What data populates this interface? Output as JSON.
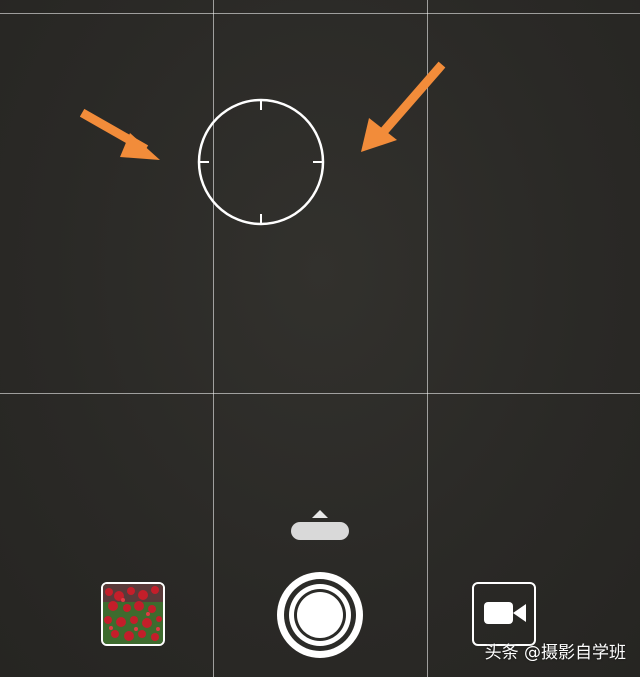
{
  "camera": {
    "mode": "photo",
    "grid": true,
    "focus_indicator": "circle-with-ticks",
    "annotation_color": "#f28c3a"
  },
  "controls": {
    "gallery_thumbnail": "gallery-thumbnail",
    "shutter": "shutter-button",
    "video_mode": "video-camera-icon",
    "expand_handle": "chevron-up-icon"
  },
  "watermark": {
    "text": "头条 @摄影自学班"
  }
}
